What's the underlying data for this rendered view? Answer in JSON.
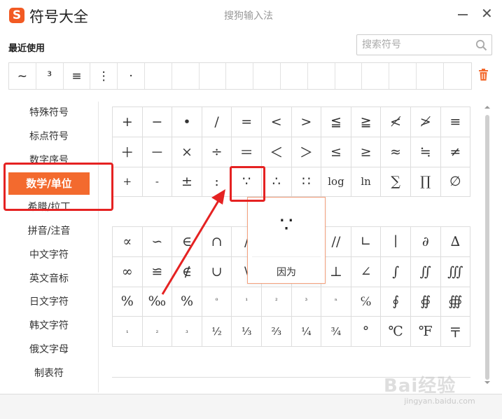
{
  "window": {
    "app_logo": "S",
    "app_title": "符号大全",
    "title": "搜狗输入法",
    "minimize_icon": "minimize-icon",
    "close_icon": "close-icon",
    "close_glyph": "✕"
  },
  "recent": {
    "label": "最近使用",
    "items": [
      "~",
      "³",
      "≡",
      "⋮",
      "·",
      "",
      "",
      "",
      "",
      "",
      "",
      "",
      "",
      "",
      "",
      "",
      ""
    ],
    "clear_icon": "trash-icon"
  },
  "search": {
    "placeholder": "搜索符号",
    "icon": "search-icon"
  },
  "sidebar": {
    "items": [
      {
        "label": "特殊符号",
        "active": false
      },
      {
        "label": "标点符号",
        "active": false
      },
      {
        "label": "数字序号",
        "active": false
      },
      {
        "label": "数学/单位",
        "active": true
      },
      {
        "label": "希腊/拉丁",
        "active": false
      },
      {
        "label": "拼音/注音",
        "active": false
      },
      {
        "label": "中文字符",
        "active": false
      },
      {
        "label": "英文音标",
        "active": false
      },
      {
        "label": "日文字符",
        "active": false
      },
      {
        "label": "韩文字符",
        "active": false
      },
      {
        "label": "俄文字母",
        "active": false
      },
      {
        "label": "制表符",
        "active": false
      }
    ]
  },
  "symbols": {
    "group1": [
      "+",
      "−",
      "•",
      "/",
      "=",
      "<",
      ">",
      "≦",
      "≧",
      "≮",
      "≯",
      "≡",
      "＋",
      "－",
      "×",
      "÷",
      "＝",
      "＜",
      "＞",
      "≤",
      "≥",
      "≈",
      "≒",
      "≠",
      "+",
      "-",
      "±",
      ":",
      "∵",
      "∴",
      "∷",
      "log",
      "ln",
      "∑",
      "∏",
      "∅"
    ],
    "group2": [
      "∝",
      "∽",
      "∈",
      "∩",
      "/",
      "",
      "",
      "//",
      "∟",
      "∣",
      "∂",
      "∆",
      "∞",
      "≌",
      "∉",
      "∪",
      "\\",
      "",
      "",
      "⊥",
      "∠",
      "∫",
      "∬",
      "∭",
      "%",
      "‰",
      "%",
      "⁰",
      "¹",
      "²",
      "³",
      "ⁿ",
      "℅",
      "∮",
      "∯",
      "∰",
      "₁",
      "₂",
      "₃",
      "½",
      "⅓",
      "⅔",
      "¼",
      "¾",
      "°",
      "℃",
      "℉",
      "〒"
    ]
  },
  "tooltip": {
    "symbol": "∵",
    "name": "因为"
  },
  "colors": {
    "accent": "#f36a2e",
    "annotation_red": "#e52222"
  },
  "watermark": {
    "text": "Bai经验",
    "sub": "jingyan.baidu.com"
  }
}
